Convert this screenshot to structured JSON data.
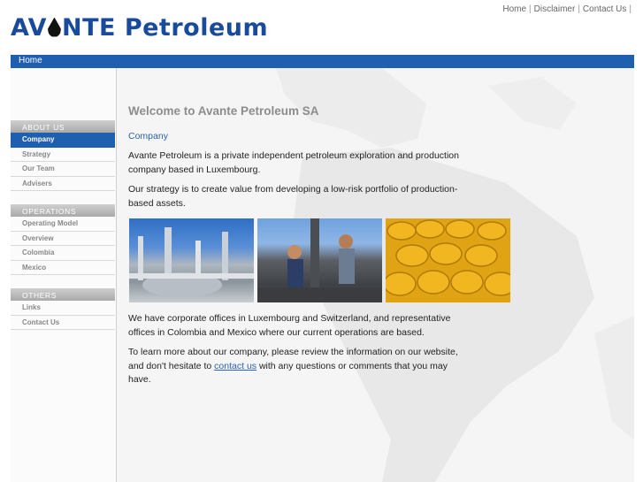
{
  "header": {
    "logo_pre": "AV",
    "logo_post": "NTE Petroleum",
    "top_links": [
      "Home",
      "Disclaimer",
      "Contact Us"
    ]
  },
  "navbar": {
    "home": "Home"
  },
  "sidebar": {
    "groups": [
      {
        "title": "ABOUT US",
        "items": [
          "Company",
          "Strategy",
          "Our Team",
          "Advisers"
        ],
        "active": "Company"
      },
      {
        "title": "OPERATIONS",
        "items": [
          "Operating Model",
          "Overview",
          "Colombia",
          "Mexico"
        ]
      },
      {
        "title": "OTHERS",
        "items": [
          "Links",
          "Contact Us"
        ]
      }
    ]
  },
  "main": {
    "title": "Welcome to Avante Petroleum SA",
    "subheading": "Company",
    "para1": "Avante Petroleum is a private independent petroleum exploration and production company based in Luxembourg.",
    "para2": "Our strategy is to create value from developing a low-risk portfolio of production-based assets.",
    "para3": "We have corporate offices in Luxembourg and Switzerland, and representative offices in Colombia and Mexico where our current operations are based.",
    "para4_before": "To learn more about our company, please review the information on our website, and don't hesitate to ",
    "para4_link": "contact us",
    "para4_after": " with any questions or comments that you may have."
  },
  "colors": {
    "brand_blue": "#1e5fb0",
    "link_blue": "#2a63b0",
    "menu_grey": "#a9a9a9"
  },
  "icons": [
    "oil-drop-icon"
  ]
}
